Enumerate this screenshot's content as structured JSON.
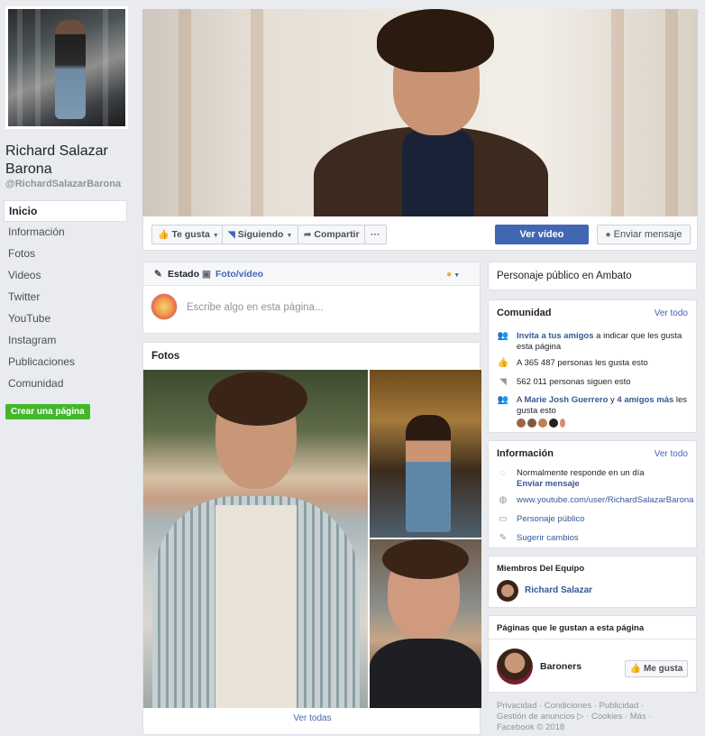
{
  "page": {
    "name": "Richard Salazar Barona",
    "handle": "@RichardSalazarBarona"
  },
  "nav": {
    "items": [
      "Inicio",
      "Información",
      "Fotos",
      "Videos",
      "Twitter",
      "YouTube",
      "Instagram",
      "Publicaciones",
      "Comunidad"
    ],
    "create_page": "Crear una página"
  },
  "actions": {
    "like": "Te gusta",
    "following": "Siguiendo",
    "share": "Compartir",
    "more": "···",
    "watch_video": "Ver vídeo",
    "send_message": "Enviar mensaje"
  },
  "composer": {
    "tab_status": "Estado",
    "tab_photo": "Foto/vídeo",
    "placeholder": "Escribe algo en esta página..."
  },
  "photos": {
    "title": "Fotos",
    "see_all": "Ver todas"
  },
  "about": {
    "category": "Personaje público en Ambato"
  },
  "community": {
    "title": "Comunidad",
    "see_all": "Ver todo",
    "invite_link": "Invita a tus amigos",
    "invite_rest": "a indicar que les gusta esta página",
    "likes": "A 365 487 personas les gusta esto",
    "followers": "562 011 personas siguen esto",
    "friends_prefix": "A",
    "friend_name": "Marie Josh Guerrero",
    "friends_mid": "y",
    "friends_more": "4 amigos más",
    "friends_suffix": "les gusta esto"
  },
  "info": {
    "title": "Información",
    "see_all": "Ver todo",
    "response": "Normalmente responde en un día",
    "send_message": "Enviar mensaje",
    "website": "www.youtube.com/user/RichardSalazarBarona",
    "category": "Personaje público",
    "suggest": "Sugerir cambios"
  },
  "team": {
    "title": "Miembros Del Equipo",
    "member": "Richard Salazar"
  },
  "liked_pages": {
    "title": "Páginas que le gustan a esta página",
    "page_name": "Baroners",
    "like_button": "Me gusta"
  },
  "footer": {
    "line1": "Privacidad · Condiciones · Publicidad ·",
    "line2": "Gestión de anuncios ▷ · Cookies · Más ·",
    "line3": "Facebook © 2018"
  },
  "colors": {
    "brand_blue": "#4267b2",
    "link_blue": "#365899",
    "green": "#42b72a",
    "background": "#e9ebee"
  }
}
